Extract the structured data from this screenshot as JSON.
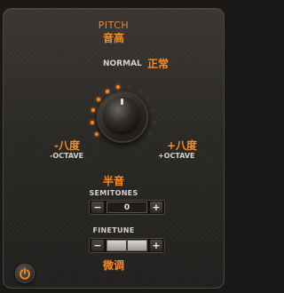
{
  "pitch": {
    "title_en": "PITCH",
    "title_cn": "音高"
  },
  "normal": {
    "label_en": "NORMAL",
    "label_cn": "正常"
  },
  "octave": {
    "minus_cn": "-八度",
    "minus_en": "-OCTAVE",
    "plus_cn": "+八度",
    "plus_en": "+OCTAVE"
  },
  "semitones": {
    "label_cn": "半音",
    "label_en": "SEMITONES",
    "value": "0",
    "minus": "−",
    "plus": "+"
  },
  "finetune": {
    "label_en": "FINETUNE",
    "label_cn": "微调",
    "minus": "−",
    "plus": "+"
  },
  "power": {
    "icon": "power-icon"
  },
  "colors": {
    "accent": "#ff8a1e",
    "label": "#d6d2cc",
    "panel": "#2b2926"
  }
}
